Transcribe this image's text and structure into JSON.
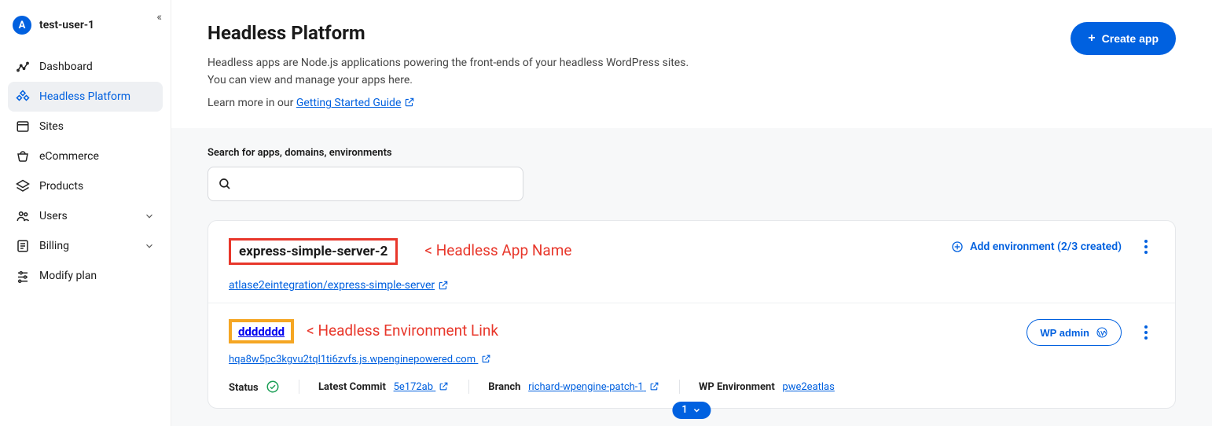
{
  "user": {
    "initial": "A",
    "name": "test-user-1"
  },
  "sidebar": {
    "items": [
      {
        "label": "Dashboard"
      },
      {
        "label": "Headless Platform"
      },
      {
        "label": "Sites"
      },
      {
        "label": "eCommerce"
      },
      {
        "label": "Products"
      },
      {
        "label": "Users"
      },
      {
        "label": "Billing"
      },
      {
        "label": "Modify plan"
      }
    ]
  },
  "header": {
    "title": "Headless Platform",
    "desc1": "Headless apps are Node.js applications powering the front-ends of your headless WordPress sites.",
    "desc2": "You can view and manage your apps here.",
    "learn_prefix": "Learn more in our ",
    "learn_link": "Getting Started Guide",
    "create_button": "Create app"
  },
  "search": {
    "label": "Search for apps, domains, environments",
    "placeholder": ""
  },
  "app": {
    "name": "express-simple-server-2",
    "annotation": "< Headless App Name",
    "repo": "atlase2eintegration/express-simple-server",
    "add_env_label": "Add environment (2/3 created)"
  },
  "env": {
    "name": "ddddddd",
    "annotation": "< Headless Environment Link",
    "url": "hqa8w5pc3kgvu2tql1ti6zvfs.js.wpenginepowered.com",
    "wp_admin_label": "WP admin",
    "meta": {
      "status_label": "Status",
      "latest_commit_label": "Latest Commit",
      "latest_commit_value": "5e172ab",
      "branch_label": "Branch",
      "branch_value": "richard-wpengine-patch-1",
      "wp_env_label": "WP Environment",
      "wp_env_value": "pwe2eatlas"
    }
  },
  "pager": {
    "value": "1"
  }
}
